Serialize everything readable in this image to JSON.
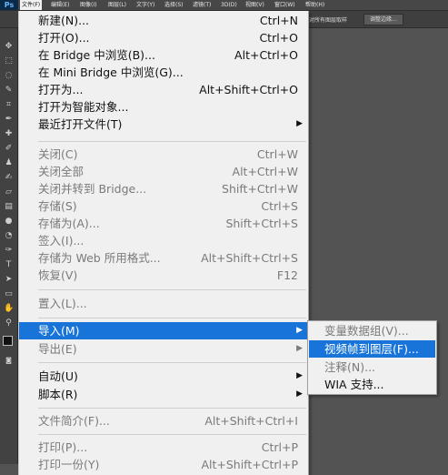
{
  "app": {
    "logo": "Ps"
  },
  "menubar": {
    "items": [
      {
        "label": "文件(F)",
        "active": true
      },
      {
        "label": "编辑(E)"
      },
      {
        "label": "图像(I)"
      },
      {
        "label": "图层(L)"
      },
      {
        "label": "文字(Y)"
      },
      {
        "label": "选择(S)"
      },
      {
        "label": "滤镜(T)"
      },
      {
        "label": "3D(D)"
      },
      {
        "label": "视图(V)"
      },
      {
        "label": "窗口(W)"
      },
      {
        "label": "帮助(H)"
      }
    ]
  },
  "optionsbar": {
    "partial_text": "对所有图层取样",
    "button_label": "调整边缘..."
  },
  "file_menu": {
    "items": [
      {
        "label": "新建(N)...",
        "shortcut": "Ctrl+N"
      },
      {
        "label": "打开(O)...",
        "shortcut": "Ctrl+O"
      },
      {
        "label": "在 Bridge 中浏览(B)...",
        "shortcut": "Alt+Ctrl+O"
      },
      {
        "label": "在 Mini Bridge 中浏览(G)...",
        "shortcut": ""
      },
      {
        "label": "打开为...",
        "shortcut": "Alt+Shift+Ctrl+O"
      },
      {
        "label": "打开为智能对象...",
        "shortcut": ""
      },
      {
        "label": "最近打开文件(T)",
        "shortcut": "",
        "submenu": true
      },
      {
        "label": "关闭(C)",
        "shortcut": "Ctrl+W",
        "disabled": true
      },
      {
        "label": "关闭全部",
        "shortcut": "Alt+Ctrl+W",
        "disabled": true
      },
      {
        "label": "关闭并转到 Bridge...",
        "shortcut": "Shift+Ctrl+W",
        "disabled": true
      },
      {
        "label": "存储(S)",
        "shortcut": "Ctrl+S",
        "disabled": true
      },
      {
        "label": "存储为(A)...",
        "shortcut": "Shift+Ctrl+S",
        "disabled": true
      },
      {
        "label": "签入(I)...",
        "shortcut": "",
        "disabled": true
      },
      {
        "label": "存储为 Web 所用格式...",
        "shortcut": "Alt+Shift+Ctrl+S",
        "disabled": true
      },
      {
        "label": "恢复(V)",
        "shortcut": "F12",
        "disabled": true
      },
      {
        "label": "置入(L)...",
        "shortcut": "",
        "disabled": true
      },
      {
        "label": "导入(M)",
        "shortcut": "",
        "submenu": true,
        "highlighted": true
      },
      {
        "label": "导出(E)",
        "shortcut": "",
        "submenu": true,
        "disabled": true
      },
      {
        "label": "自动(U)",
        "shortcut": "",
        "submenu": true
      },
      {
        "label": "脚本(R)",
        "shortcut": "",
        "submenu": true
      },
      {
        "label": "文件简介(F)...",
        "shortcut": "Alt+Shift+Ctrl+I",
        "disabled": true
      },
      {
        "label": "打印(P)...",
        "shortcut": "Ctrl+P",
        "disabled": true
      },
      {
        "label": "打印一份(Y)",
        "shortcut": "Alt+Shift+Ctrl+P",
        "disabled": true
      }
    ],
    "submenu_arrow": "▶"
  },
  "import_submenu": {
    "items": [
      {
        "label": "变量数据组(V)...",
        "disabled": true
      },
      {
        "label": "视频帧到图层(F)...",
        "highlighted": true
      },
      {
        "label": "注释(N)...",
        "disabled": true
      },
      {
        "label": "WIA 支持..."
      }
    ]
  },
  "colors": {
    "highlight": "#1874d8",
    "menu_bg": "#f0f0f0",
    "workspace": "#535353",
    "disabled_text": "#7a7a7a"
  }
}
